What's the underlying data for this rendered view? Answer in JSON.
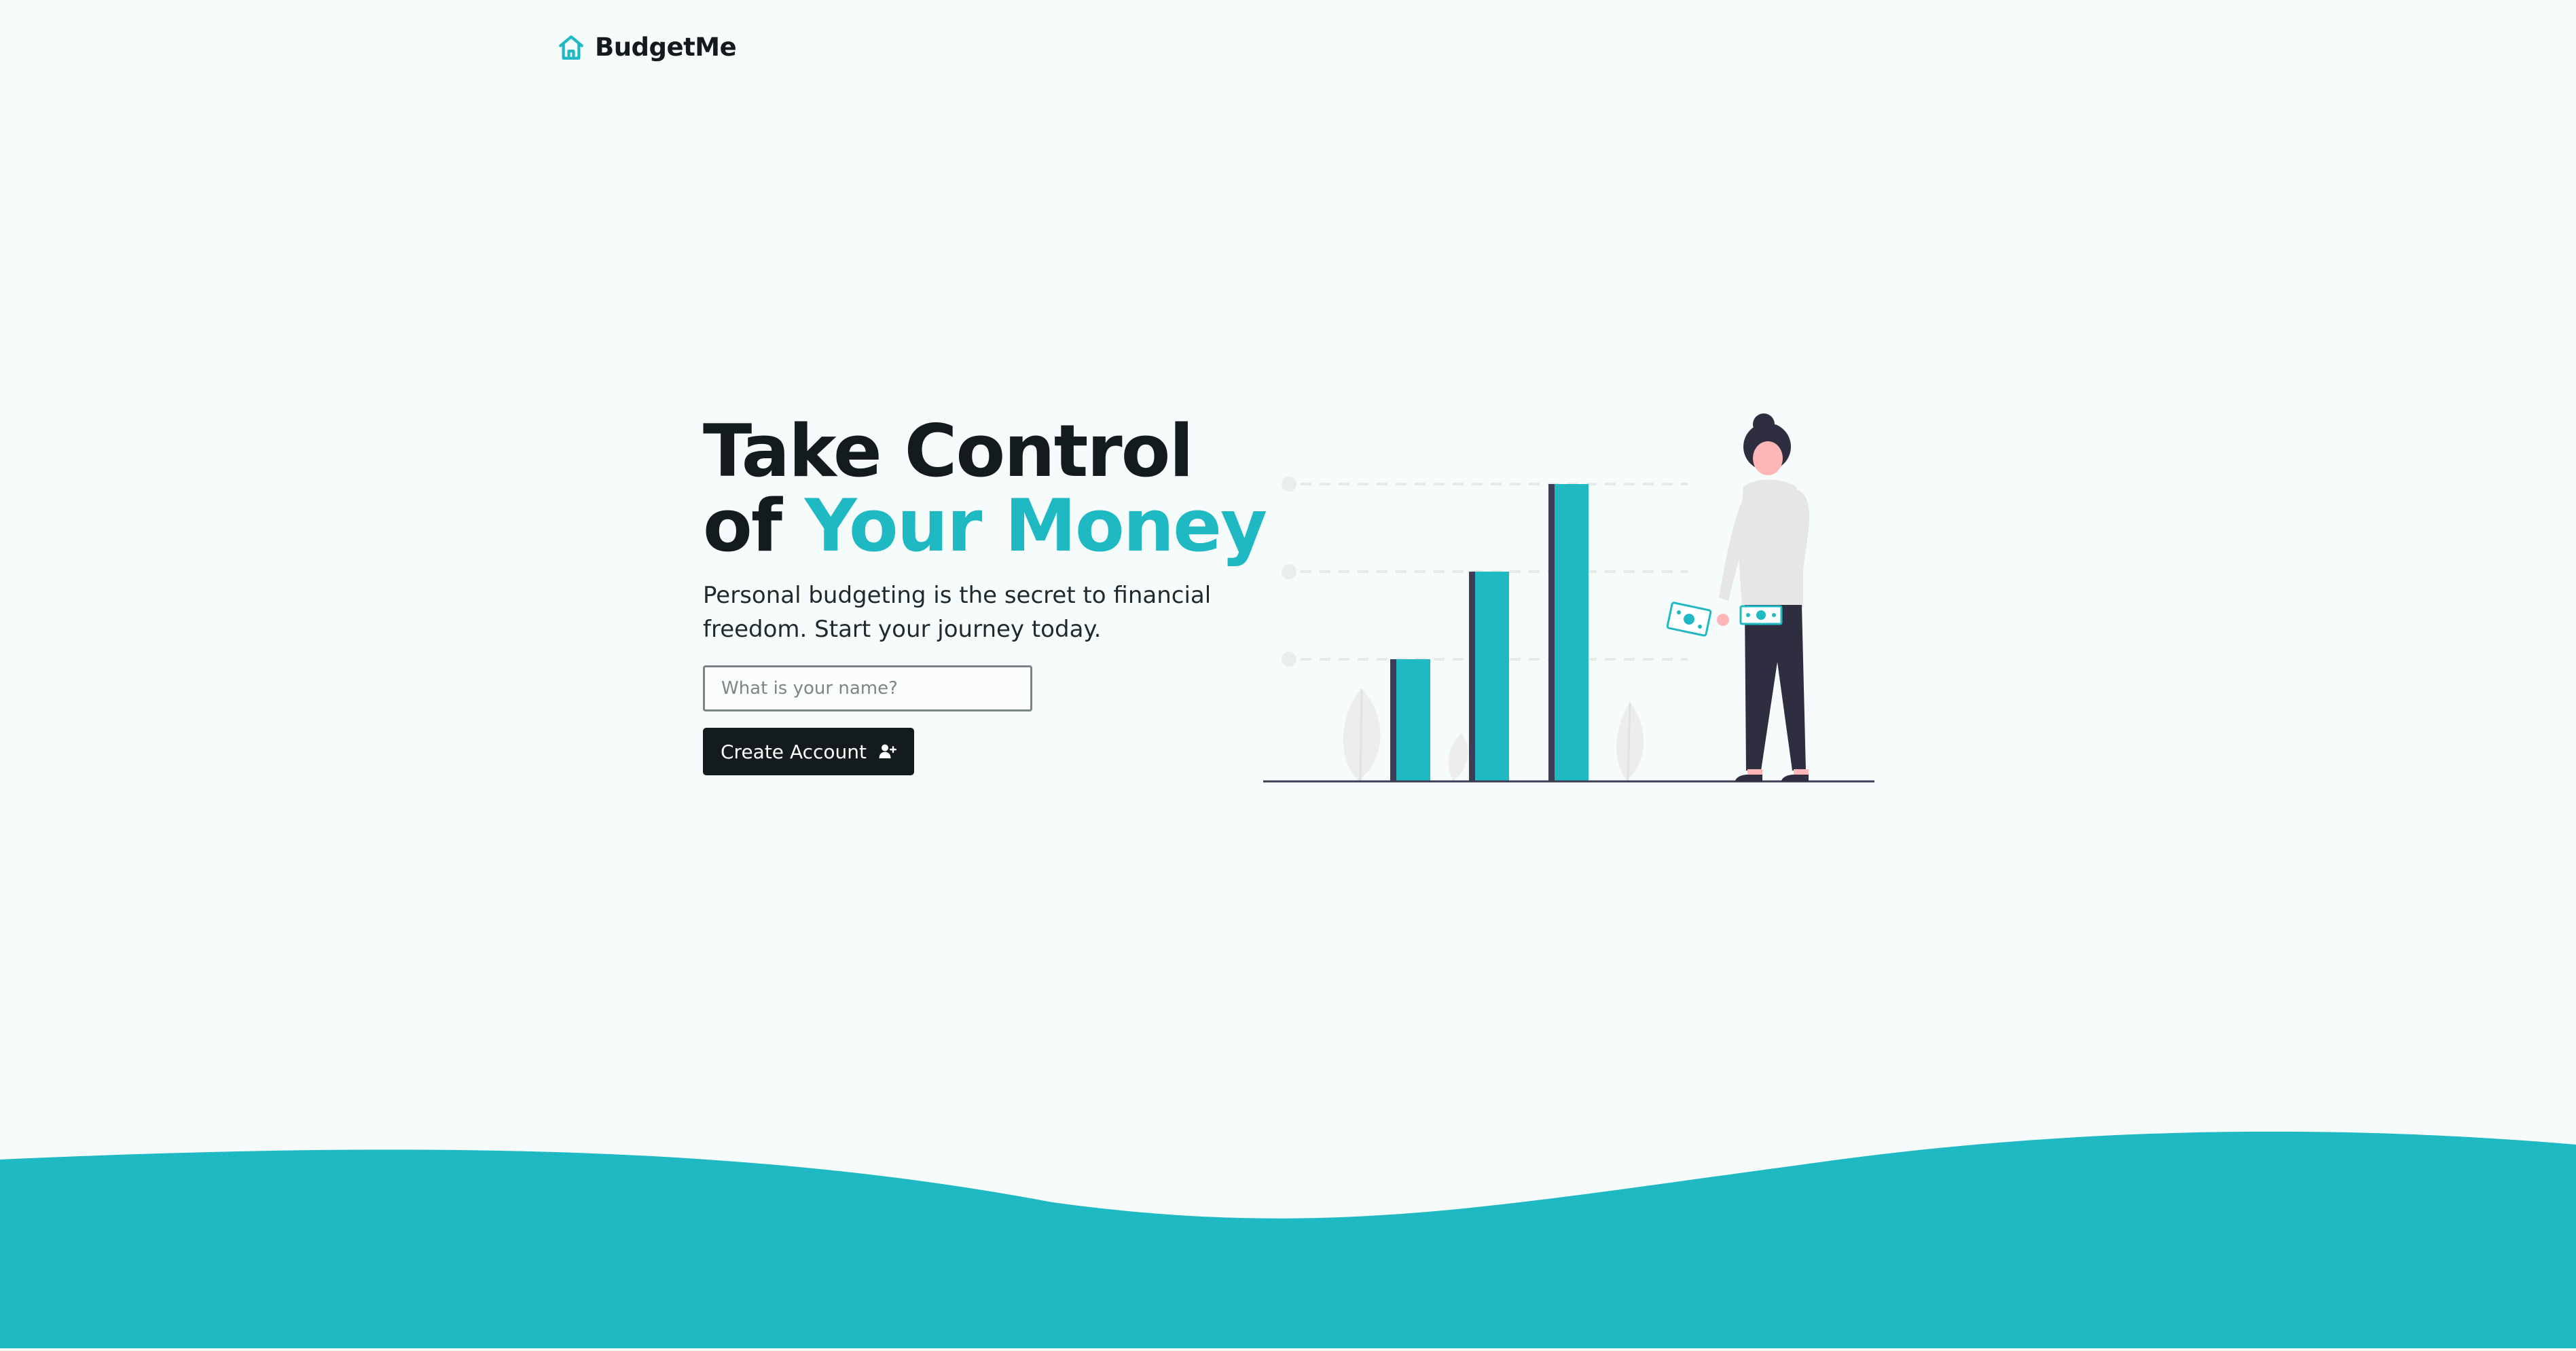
{
  "brand": {
    "name": "BudgetMe",
    "icon": "home-icon"
  },
  "hero": {
    "title_line1": "Take Control",
    "title_line2_prefix": "of ",
    "title_line2_accent": "Your Money",
    "description": "Personal budgeting is the secret to financial freedom. Start your journey today."
  },
  "form": {
    "name_placeholder": "What is your name?",
    "name_value": "",
    "submit_label": "Create Account",
    "submit_icon": "user-plus-icon"
  },
  "illustration": {
    "icon": "woman-with-bar-chart-illustration"
  },
  "colors": {
    "accent": "#1fb9c3",
    "dark": "#131b1c",
    "background": "#f6fbfb"
  }
}
